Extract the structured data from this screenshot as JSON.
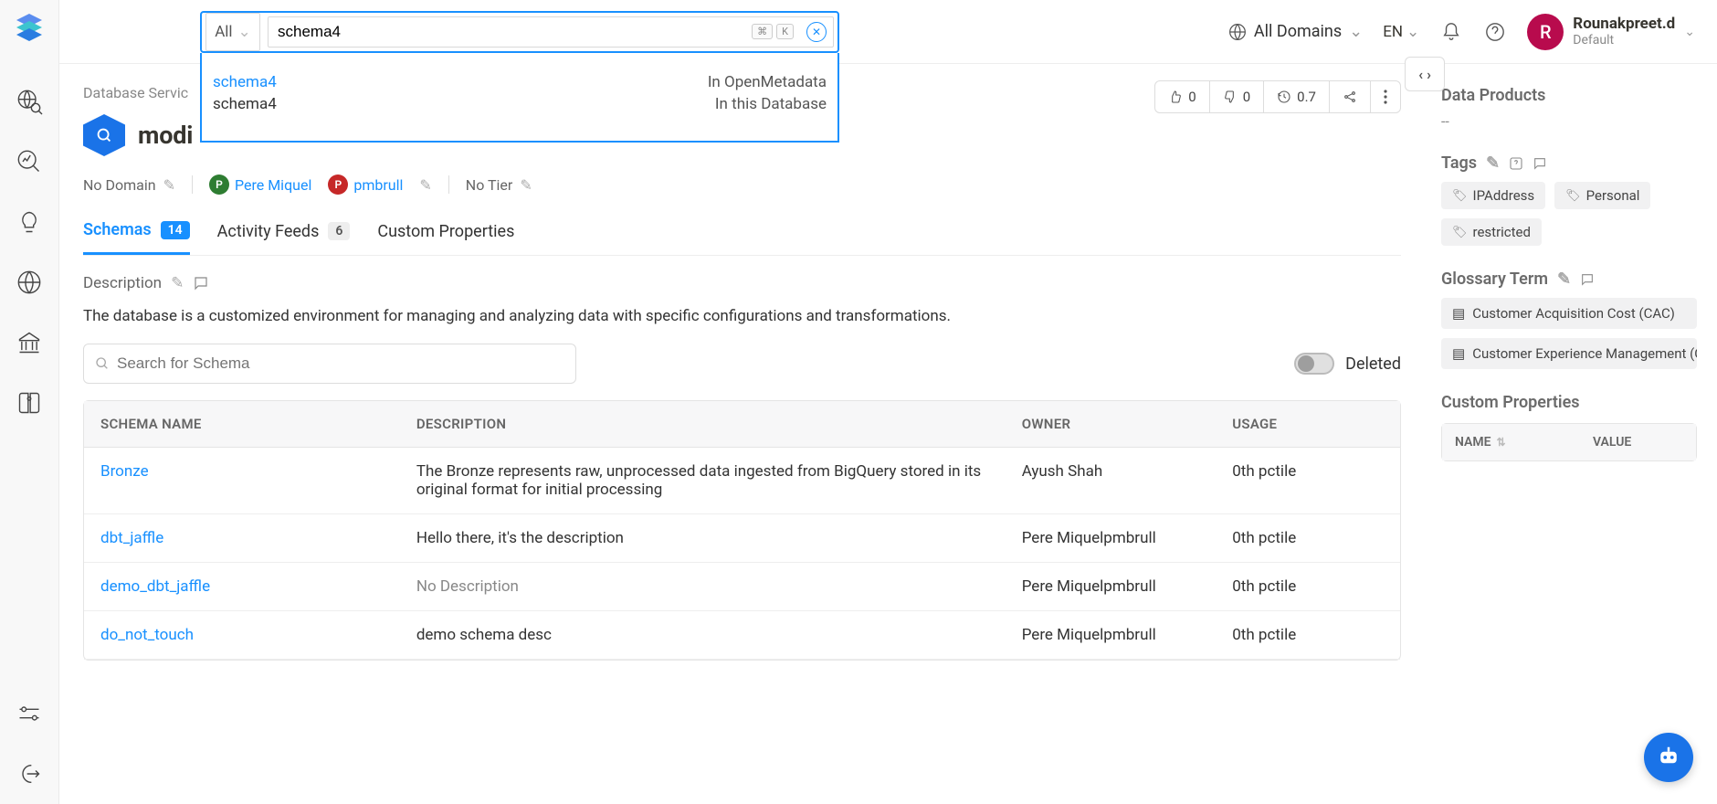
{
  "search": {
    "filter": "All",
    "value": "schema4",
    "kbd1": "⌘",
    "kbd2": "K",
    "suggestions": [
      {
        "left": "schema4",
        "right": "In OpenMetadata",
        "highlight": true
      },
      {
        "left": "schema4",
        "right": "In this Database",
        "highlight": false
      }
    ]
  },
  "header": {
    "domains": "All Domains",
    "lang": "EN",
    "user_initial": "R",
    "user_name": "Rounakpreet.d",
    "user_sub": "Default"
  },
  "action_bar": {
    "likes": "0",
    "dislikes": "0",
    "score": "0.7"
  },
  "breadcrumb": "Database Servic",
  "db_title": "modi",
  "meta": {
    "no_domain": "No Domain",
    "owner1": "Pere Miquel",
    "owner2": "pmbrull",
    "no_tier": "No Tier"
  },
  "tabs": {
    "schemas": "Schemas",
    "schemas_count": "14",
    "activity": "Activity Feeds",
    "activity_count": "6",
    "custom": "Custom Properties"
  },
  "description_label": "Description",
  "description_text": "The database is a customized environment for managing and analyzing data with specific configurations and transformations.",
  "schema_search_placeholder": "Search for Schema",
  "deleted_label": "Deleted",
  "table": {
    "col_schema": "SCHEMA NAME",
    "col_desc": "DESCRIPTION",
    "col_owner": "OWNER",
    "col_usage": "USAGE",
    "rows": [
      {
        "name": "Bronze",
        "desc": "The Bronze represents raw, unprocessed data ingested from BigQuery stored in its original format for initial processing",
        "owner": "Ayush Shah",
        "usage": "0th pctile",
        "muted": false
      },
      {
        "name": "dbt_jaffle",
        "desc": "Hello there, it's the description",
        "owner": "Pere Miquelpmbrull",
        "usage": "0th pctile",
        "muted": false
      },
      {
        "name": "demo_dbt_jaffle",
        "desc": "No Description",
        "owner": "Pere Miquelpmbrull",
        "usage": "0th pctile",
        "muted": true
      },
      {
        "name": "do_not_touch",
        "desc": "demo schema desc",
        "owner": "Pere Miquelpmbrull",
        "usage": "0th pctile",
        "muted": false
      }
    ]
  },
  "right": {
    "data_products_title": "Data Products",
    "data_products_value": "--",
    "tags_title": "Tags",
    "tags": [
      "IPAddress",
      "Personal",
      "restricted"
    ],
    "glossary_title": "Glossary Term",
    "glossary_items": [
      "Customer Acquisition Cost (CAC)",
      "Customer Experience Management (C..."
    ],
    "cp_title": "Custom Properties",
    "cp_col_name": "NAME",
    "cp_col_value": "VALUE"
  }
}
